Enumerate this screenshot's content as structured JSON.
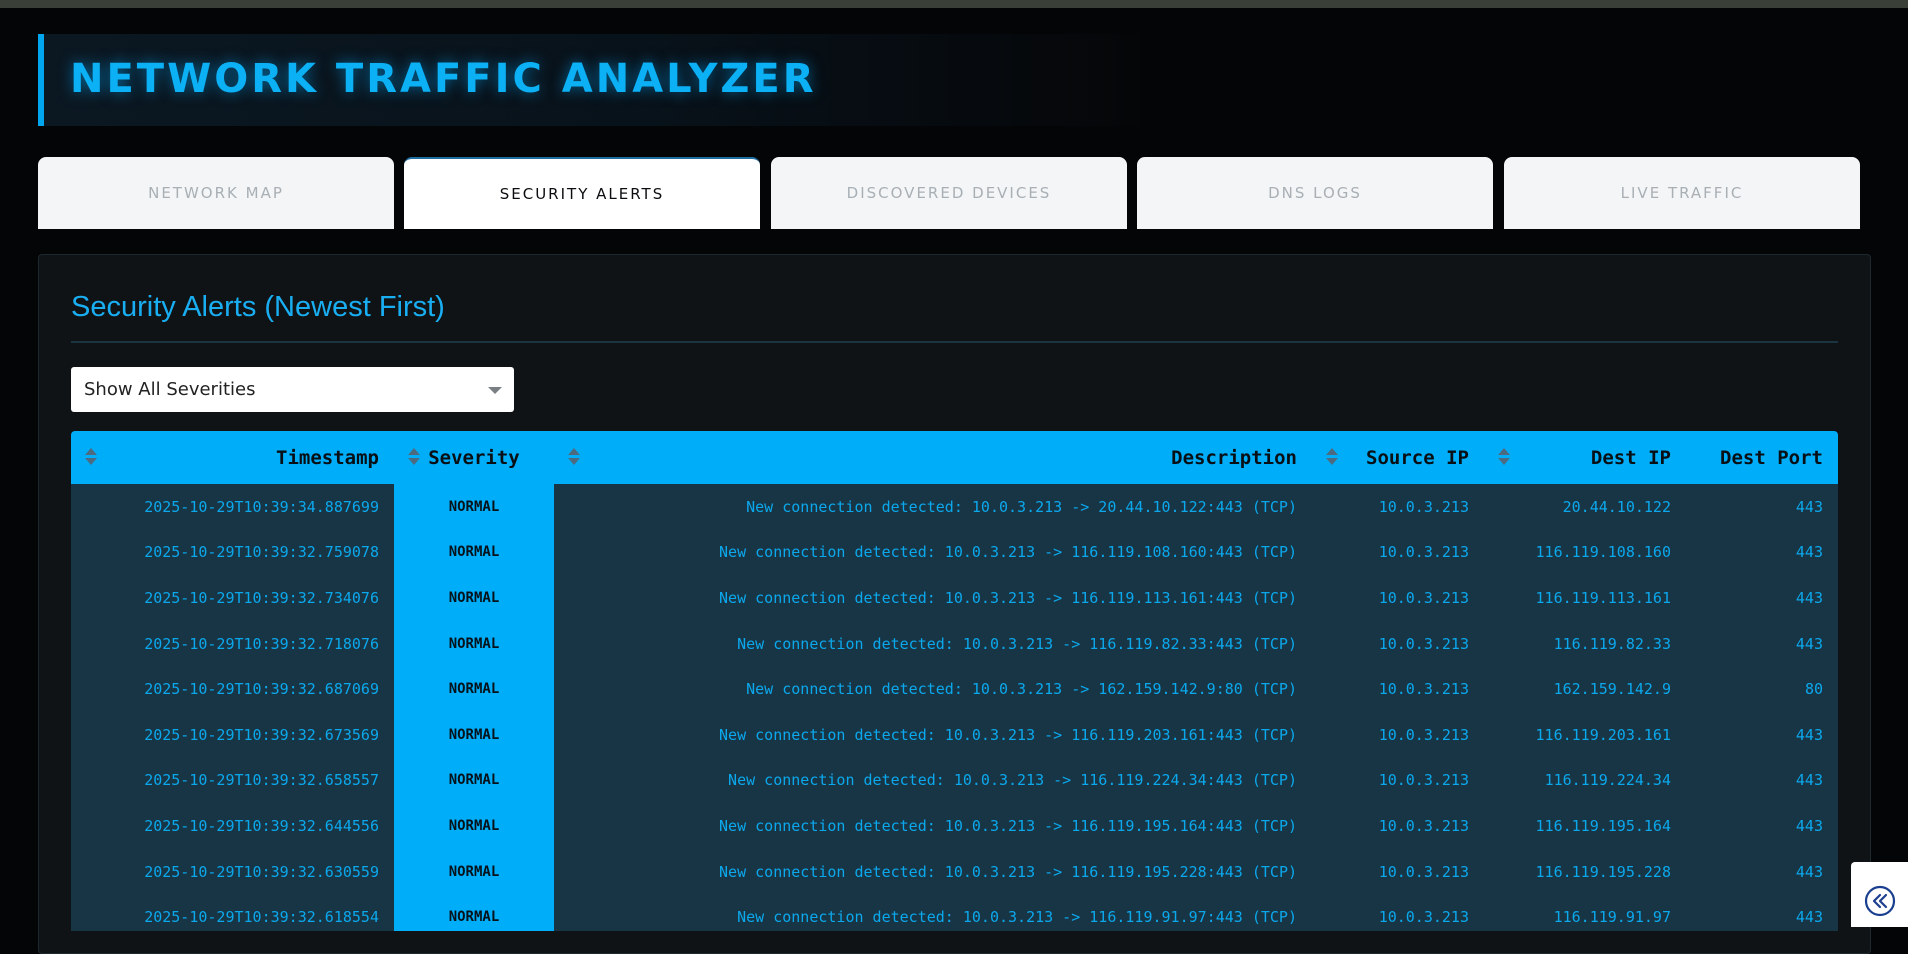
{
  "app": {
    "title": "NETWORK TRAFFIC ANALYZER"
  },
  "tabs": [
    {
      "label": "NETWORK MAP",
      "active": false
    },
    {
      "label": "SECURITY ALERTS",
      "active": true
    },
    {
      "label": "DISCOVERED DEVICES",
      "active": false
    },
    {
      "label": "DNS LOGS",
      "active": false
    },
    {
      "label": "LIVE TRAFFIC",
      "active": false
    }
  ],
  "alerts": {
    "heading": "Security Alerts (Newest First)",
    "filter": {
      "selected": "Show All Severities"
    },
    "columns": [
      "Timestamp",
      "Severity",
      "Description",
      "Source IP",
      "Dest IP",
      "Dest Port"
    ],
    "rows": [
      [
        "2025-10-29T10:39:34.887699",
        "NORMAL",
        "New connection detected: 10.0.3.213 -> 20.44.10.122:443 (TCP)",
        "10.0.3.213",
        "20.44.10.122",
        "443"
      ],
      [
        "2025-10-29T10:39:32.759078",
        "NORMAL",
        "New connection detected: 10.0.3.213 -> 116.119.108.160:443 (TCP)",
        "10.0.3.213",
        "116.119.108.160",
        "443"
      ],
      [
        "2025-10-29T10:39:32.734076",
        "NORMAL",
        "New connection detected: 10.0.3.213 -> 116.119.113.161:443 (TCP)",
        "10.0.3.213",
        "116.119.113.161",
        "443"
      ],
      [
        "2025-10-29T10:39:32.718076",
        "NORMAL",
        "New connection detected: 10.0.3.213 -> 116.119.82.33:443 (TCP)",
        "10.0.3.213",
        "116.119.82.33",
        "443"
      ],
      [
        "2025-10-29T10:39:32.687069",
        "NORMAL",
        "New connection detected: 10.0.3.213 -> 162.159.142.9:80 (TCP)",
        "10.0.3.213",
        "162.159.142.9",
        "80"
      ],
      [
        "2025-10-29T10:39:32.673569",
        "NORMAL",
        "New connection detected: 10.0.3.213 -> 116.119.203.161:443 (TCP)",
        "10.0.3.213",
        "116.119.203.161",
        "443"
      ],
      [
        "2025-10-29T10:39:32.658557",
        "NORMAL",
        "New connection detected: 10.0.3.213 -> 116.119.224.34:443 (TCP)",
        "10.0.3.213",
        "116.119.224.34",
        "443"
      ],
      [
        "2025-10-29T10:39:32.644556",
        "NORMAL",
        "New connection detected: 10.0.3.213 -> 116.119.195.164:443 (TCP)",
        "10.0.3.213",
        "116.119.195.164",
        "443"
      ],
      [
        "2025-10-29T10:39:32.630559",
        "NORMAL",
        "New connection detected: 10.0.3.213 -> 116.119.195.228:443 (TCP)",
        "10.0.3.213",
        "116.119.195.228",
        "443"
      ],
      [
        "2025-10-29T10:39:32.618554",
        "NORMAL",
        "New connection detected: 10.0.3.213 -> 116.119.91.97:443 (TCP)",
        "10.0.3.213",
        "116.119.91.97",
        "443"
      ]
    ]
  },
  "widgets": {
    "collapse_icon": "double-chevron-left-icon"
  },
  "colors": {
    "accent": "#00adf9",
    "background": "#040506",
    "row_bg": "#183546",
    "row_text": "#0ba8ec"
  }
}
